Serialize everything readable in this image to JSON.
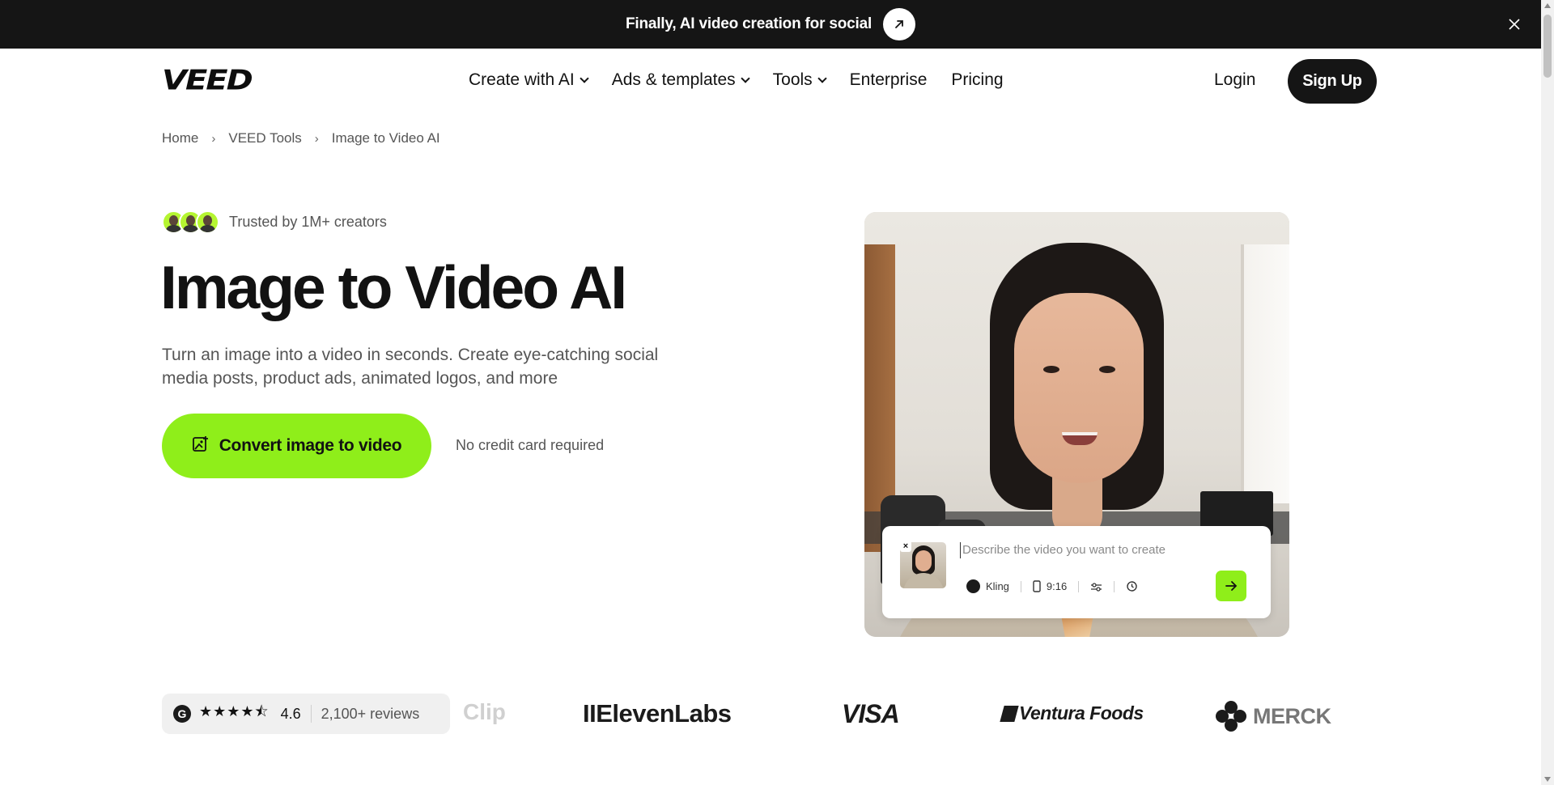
{
  "announcement": {
    "text": "Finally, AI video creation for social"
  },
  "nav": {
    "logo": "VEED",
    "links": [
      {
        "label": "Create with AI",
        "dropdown": true
      },
      {
        "label": "Ads & templates",
        "dropdown": true
      },
      {
        "label": "Tools",
        "dropdown": true
      },
      {
        "label": "Enterprise",
        "dropdown": false
      },
      {
        "label": "Pricing",
        "dropdown": false
      }
    ],
    "login": "Login",
    "signup": "Sign Up"
  },
  "breadcrumb": {
    "items": [
      "Home",
      "VEED Tools",
      "Image to Video AI"
    ],
    "separator": "›"
  },
  "hero": {
    "trusted": "Trusted by 1M+ creators",
    "title": "Image to Video AI",
    "subtitle": "Turn an image into a video in seconds. Create eye-catching social media posts, product ads, animated logos, and more",
    "cta": "Convert image to video",
    "note": "No credit card required"
  },
  "prompt": {
    "placeholder": "Describe the video you want to create",
    "model": "Kling",
    "ratio": "9:16"
  },
  "rating": {
    "platform_letter": "G",
    "stars": "★★★★⯪",
    "score": "4.6",
    "reviews": "2,100+ reviews"
  },
  "brands": {
    "clip": "Clip",
    "elevenlabs": "IIElevenLabs",
    "visa": "VISA",
    "ventura": "Ventura Foods",
    "merck": "MERCK"
  },
  "colors": {
    "accent": "#8fee1a",
    "dark": "#151515",
    "text_secondary": "#555555"
  }
}
